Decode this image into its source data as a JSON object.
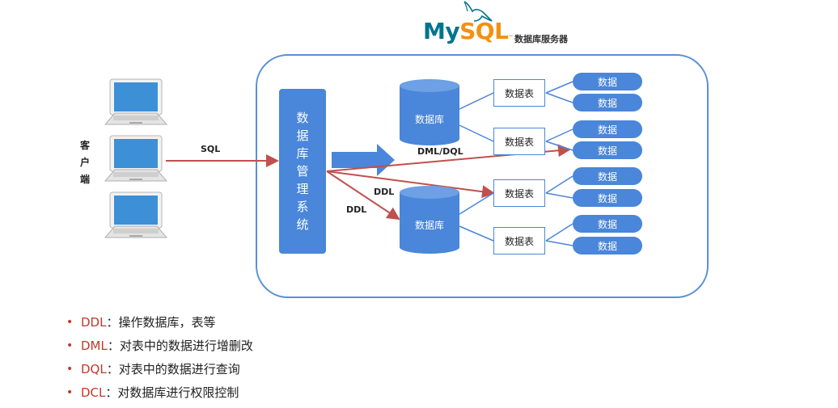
{
  "header": {
    "logo_my": "My",
    "logo_sql": "SQL",
    "logo_tm": "™",
    "server_title": "数据库服务器"
  },
  "client": {
    "label": "客户端"
  },
  "edges": {
    "sql": "SQL",
    "dml_dql": "DML/DQL",
    "ddl_upper": "DDL",
    "ddl_lower": "DDL"
  },
  "dbms": {
    "label": "数据库管理系统"
  },
  "databases": [
    {
      "label": "数据库"
    },
    {
      "label": "数据库"
    }
  ],
  "tables": [
    {
      "label": "数据表",
      "rows": [
        "数据",
        "数据"
      ]
    },
    {
      "label": "数据表",
      "rows": [
        "数据",
        "数据"
      ]
    },
    {
      "label": "数据表",
      "rows": [
        "数据",
        "数据"
      ]
    },
    {
      "label": "数据表",
      "rows": [
        "数据",
        "数据"
      ]
    }
  ],
  "bullets": [
    {
      "keyword": "DDL",
      "sep": "：",
      "text": "操作数据库，表等"
    },
    {
      "keyword": "DML",
      "sep": "：",
      "text": "对表中的数据进行增删改"
    },
    {
      "keyword": "DQL",
      "sep": "：",
      "text": "对表中的数据进行查询"
    },
    {
      "keyword": "DCL",
      "sep": "：",
      "text": "对数据库进行权限控制"
    }
  ],
  "colors": {
    "accent_blue": "#4a86d9",
    "arrow_red": "#c0504d",
    "bullet_red": "#c0392b"
  }
}
